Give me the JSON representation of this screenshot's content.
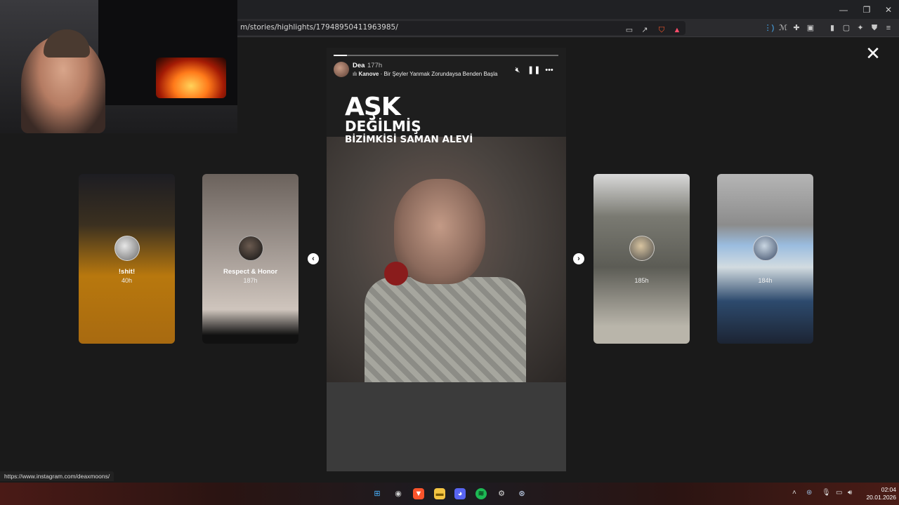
{
  "browser": {
    "url": "m/stories/highlights/17948950411963985/",
    "status_link": "https://www.instagram.com/deaxmoons/"
  },
  "story": {
    "username": "Dea",
    "time": "177h",
    "music_artist": "Kanove",
    "music_separator": " · ",
    "music_title": "Bir Şeyler Yanmak Zorundaysa Benden Başla",
    "text_line1": "AŞK",
    "text_line2": "DEĞİLMİŞ",
    "text_line3": "BİZİMKİSİ SAMAN ALEVİ",
    "progress": 0.06
  },
  "cards": [
    {
      "title": "!shit!",
      "time": "40h"
    },
    {
      "title": "Respect & Honor",
      "time": "187h"
    },
    {
      "title": "",
      "time": "185h"
    },
    {
      "title": "",
      "time": "184h"
    }
  ],
  "clock": {
    "time": "02:04",
    "date": "20.01.2026"
  },
  "icons": {
    "close": "close-icon",
    "prev": "chevron-left-icon",
    "next": "chevron-right-icon",
    "mute": "mute-icon",
    "pause": "pause-icon",
    "more": "more-icon"
  }
}
